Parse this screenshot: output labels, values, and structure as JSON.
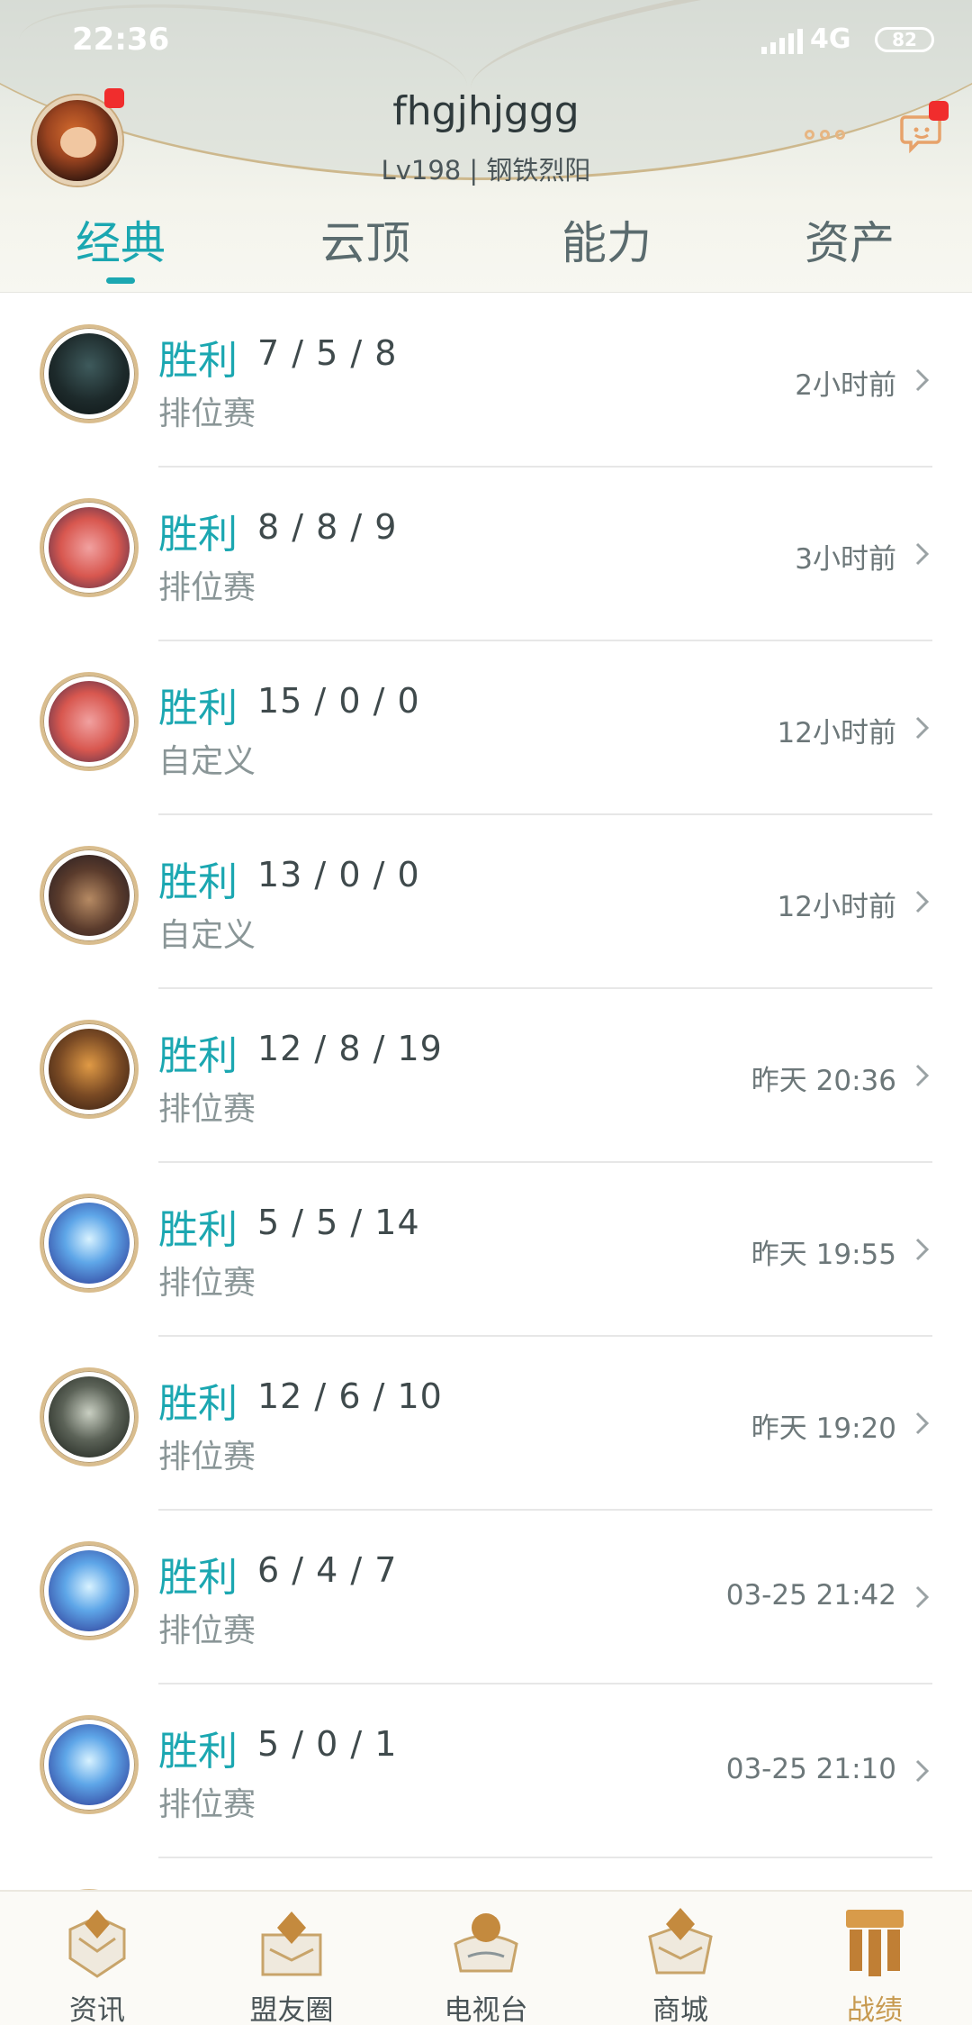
{
  "status_bar": {
    "time": "22:36",
    "network": "4G",
    "battery": "82"
  },
  "profile": {
    "username": "fhgjhjggg",
    "level_rank": "Lv198 | 钢铁烈阳",
    "more_icon": "ellipsis-icon",
    "chat_icon": "chat-bubble-icon"
  },
  "tabs": [
    {
      "label": "经典",
      "active": true
    },
    {
      "label": "云顶",
      "active": false
    },
    {
      "label": "能力",
      "active": false
    },
    {
      "label": "资产",
      "active": false
    }
  ],
  "matches": [
    {
      "result": "胜利",
      "kda": "7 / 5 / 8",
      "mode": "排位赛",
      "time": "2小时前",
      "champion": "champion-dark-knight"
    },
    {
      "result": "胜利",
      "kda": "8 / 8 / 9",
      "mode": "排位赛",
      "time": "3小时前",
      "champion": "champion-pink-hair"
    },
    {
      "result": "胜利",
      "kda": "15 / 0 / 0",
      "mode": "自定义",
      "time": "12小时前",
      "champion": "champion-pink-hair"
    },
    {
      "result": "胜利",
      "kda": "13 / 0 / 0",
      "mode": "自定义",
      "time": "12小时前",
      "champion": "champion-gunslinger"
    },
    {
      "result": "胜利",
      "kda": "12 / 8 / 19",
      "mode": "排位赛",
      "time": "昨天 20:36",
      "champion": "champion-bronze-armor"
    },
    {
      "result": "胜利",
      "kda": "5 / 5 / 14",
      "mode": "排位赛",
      "time": "昨天 19:55",
      "champion": "champion-ice-dragon"
    },
    {
      "result": "胜利",
      "kda": "12 / 6 / 10",
      "mode": "排位赛",
      "time": "昨天 19:20",
      "champion": "champion-wolf-beast"
    },
    {
      "result": "胜利",
      "kda": "6 / 4 / 7",
      "mode": "排位赛",
      "time": "03-25 21:42",
      "champion": "champion-ice-dragon"
    },
    {
      "result": "胜利",
      "kda": "5 / 0 / 1",
      "mode": "排位赛",
      "time": "03-25 21:10",
      "champion": "champion-ice-dragon"
    }
  ],
  "bottom_nav": [
    {
      "label": "资讯",
      "icon": "news-crest-icon",
      "active": false
    },
    {
      "label": "盟友圈",
      "icon": "friends-crest-icon",
      "active": false
    },
    {
      "label": "电视台",
      "icon": "tv-crest-icon",
      "active": false
    },
    {
      "label": "商城",
      "icon": "shop-crest-icon",
      "active": false
    },
    {
      "label": "战绩",
      "icon": "record-crest-icon",
      "active": true
    }
  ],
  "colors": {
    "accent": "#1ba7b1",
    "gold": "#c79a50",
    "badge": "#f02d2d"
  }
}
